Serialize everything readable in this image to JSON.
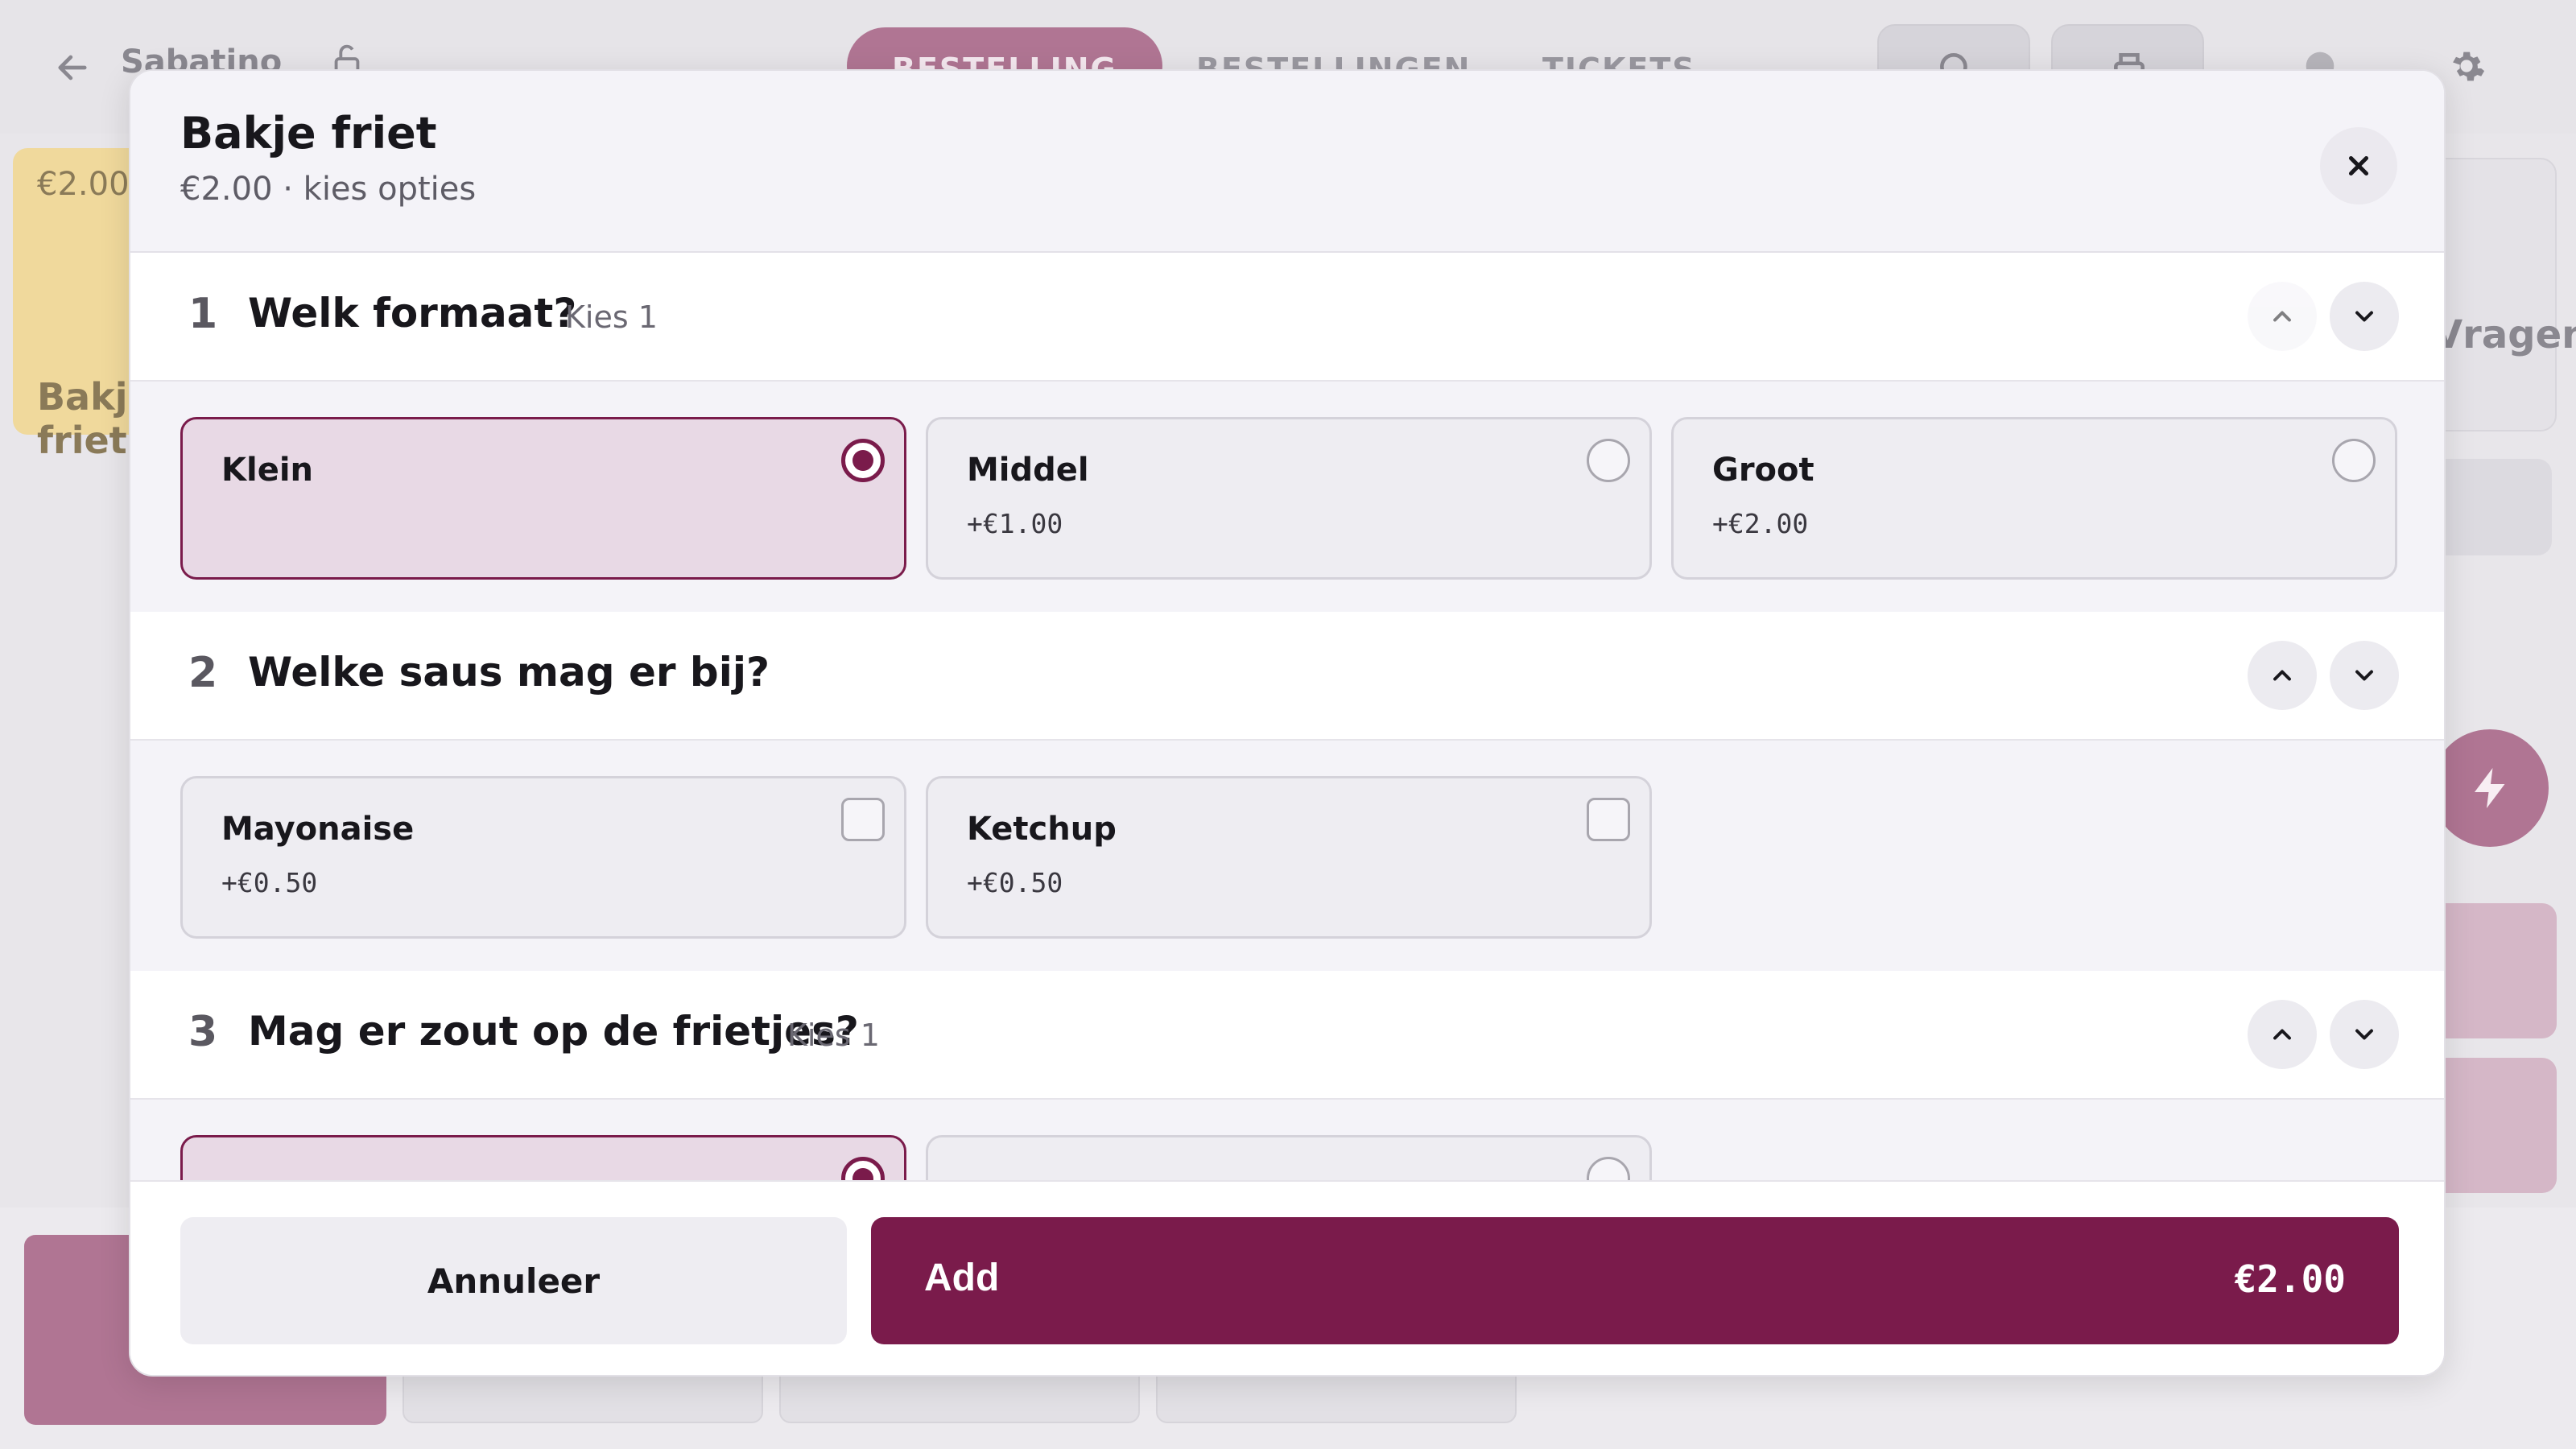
{
  "background": {
    "venue": "Sabatino",
    "tabs": [
      "BESTELLING",
      "BESTELLINGEN",
      "TICKETS"
    ],
    "product_card": {
      "price": "€2.00",
      "name": "Bakje friet"
    },
    "right_panel_text": "Vragen"
  },
  "modal": {
    "title": "Bakje friet",
    "subtitle": "€2.00 · kies opties",
    "sections": [
      {
        "number": "1",
        "title": "Welk formaat?",
        "hint": "Kies 1",
        "options": [
          {
            "name": "Klein",
            "price": "",
            "selected": true
          },
          {
            "name": "Middel",
            "price": "+€1.00",
            "selected": false
          },
          {
            "name": "Groot",
            "price": "+€2.00",
            "selected": false
          }
        ]
      },
      {
        "number": "2",
        "title": "Welke saus mag er bij?",
        "hint": "",
        "options": [
          {
            "name": "Mayonaise",
            "price": "+€0.50",
            "selected": false
          },
          {
            "name": "Ketchup",
            "price": "+€0.50",
            "selected": false
          }
        ]
      },
      {
        "number": "3",
        "title": "Mag er zout op de frietjes?",
        "hint": "Kies 1",
        "options": []
      }
    ],
    "footer": {
      "cancel_label": "Annuleer",
      "add_label": "Add",
      "total": "€2.00"
    }
  },
  "colors": {
    "accent": "#7a1b4b",
    "selected_bg": "#e8d9e5",
    "header_bg": "#f4f3f8"
  },
  "icons": [
    "back-arrow-icon",
    "lock-icon",
    "search-icon",
    "printer-icon",
    "gear-icon",
    "close-icon",
    "chevron-up-icon",
    "chevron-down-icon",
    "lightning-icon"
  ]
}
